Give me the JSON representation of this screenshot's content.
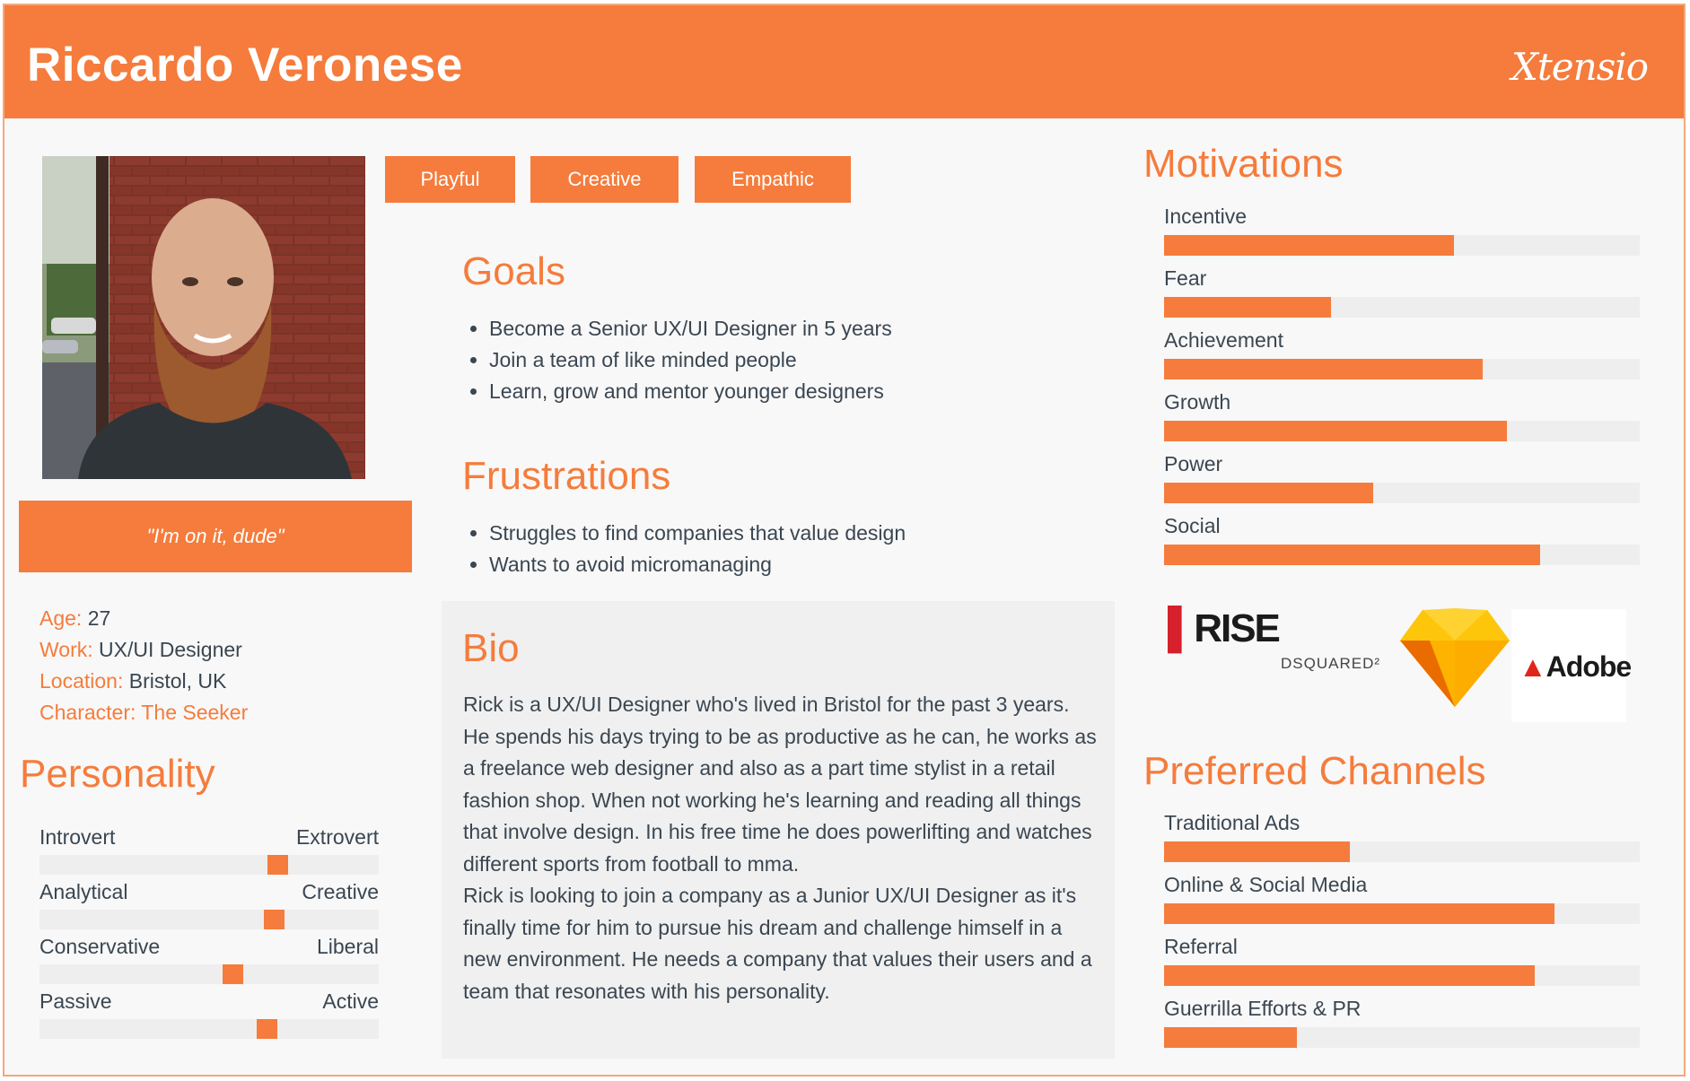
{
  "header": {
    "name": "Riccardo Veronese",
    "brand": "Xtensio"
  },
  "quote": "\"I'm on it, dude\"",
  "details": [
    {
      "label": "Age:",
      "value": " 27"
    },
    {
      "label": "Work:",
      "value": " UX/UI Designer"
    },
    {
      "label": "Location:",
      "value": " Bristol, UK"
    },
    {
      "label": "Character: The Seeker",
      "value": ""
    }
  ],
  "tags": [
    "Playful",
    "Creative",
    "Empathic"
  ],
  "goals": {
    "title": "Goals",
    "items": [
      "Become a Senior UX/UI Designer in 5 years",
      "Join a team of like minded people",
      "Learn, grow and mentor younger designers"
    ]
  },
  "frustrations": {
    "title": "Frustrations",
    "items": [
      "Struggles to find companies that value design",
      "Wants to avoid micromanaging"
    ]
  },
  "bio": {
    "title": "Bio",
    "p1": "Rick is a UX/UI Designer who's lived in Bristol for the past 3 years. He spends his days trying to be as productive as he can, he works as a freelance web designer and also as a part time stylist in a retail fashion shop. When not working he's learning and reading all things that involve design. In his free time he does powerlifting and watches different sports from football to mma.",
    "p2": "Rick is looking to join a company as a Junior UX/UI Designer as it's finally time for him to pursue his dream and challenge himself in a new environment. He needs a company that values their users and a team that resonates with his personality."
  },
  "personality": {
    "title": "Personality",
    "traits": [
      {
        "left": "Introvert",
        "right": "Extrovert",
        "value": 0.7
      },
      {
        "left": "Analytical",
        "right": "Creative",
        "value": 0.69
      },
      {
        "left": "Conservative",
        "right": "Liberal",
        "value": 0.57
      },
      {
        "left": "Passive",
        "right": "Active",
        "value": 0.67
      }
    ]
  },
  "motivations": {
    "title": "Motivations",
    "items": [
      {
        "label": "Incentive",
        "value": 0.61
      },
      {
        "label": "Fear",
        "value": 0.35
      },
      {
        "label": "Achievement",
        "value": 0.67
      },
      {
        "label": "Growth",
        "value": 0.72
      },
      {
        "label": "Power",
        "value": 0.44
      },
      {
        "label": "Social",
        "value": 0.79
      }
    ]
  },
  "brands": {
    "rise": "RISE",
    "dsquared": "DSQUARED²",
    "adobe": "Adobe"
  },
  "channels": {
    "title": "Preferred Channels",
    "items": [
      {
        "label": "Traditional Ads",
        "value": 0.39
      },
      {
        "label": "Online & Social Media",
        "value": 0.82
      },
      {
        "label": "Referral",
        "value": 0.78
      },
      {
        "label": "Guerrilla Efforts & PR",
        "value": 0.28
      }
    ]
  },
  "colors": {
    "accent": "#f57c3c",
    "track": "#eeeeee",
    "text": "#3a4651"
  }
}
